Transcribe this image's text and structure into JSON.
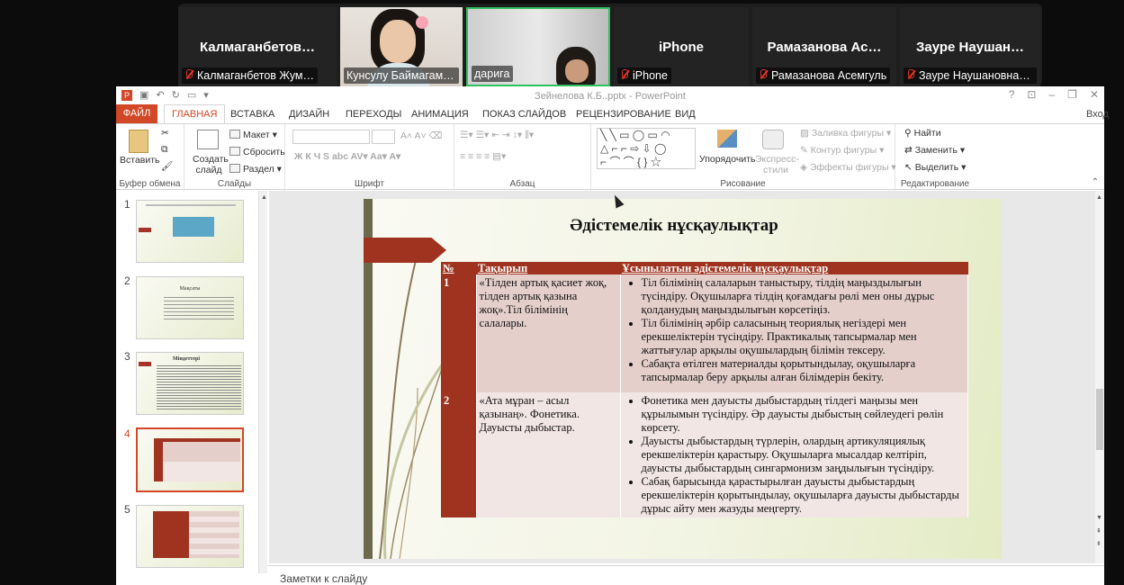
{
  "zoom": {
    "tiles": [
      {
        "name": "Калмаганбетов…",
        "label": "Калмаганбетов Жум…",
        "muted": true
      },
      {
        "name": "",
        "label": "Кунсулу Баймагамбетова",
        "muted": false
      },
      {
        "name": "",
        "label": "дарига",
        "muted": false
      },
      {
        "name": "iPhone",
        "label": "iPhone",
        "muted": true
      },
      {
        "name": "Рамазанова  Ас…",
        "label": "Рамазанова Асемгуль",
        "muted": true
      },
      {
        "name": "Зауре   Наушан…",
        "label": "Зауре   Наушановна …",
        "muted": true
      }
    ]
  },
  "ppt": {
    "window_title": "Зейнелова К.Б..pptx - PowerPoint",
    "tabs": [
      "ФАЙЛ",
      "ГЛАВНАЯ",
      "ВСТАВКА",
      "ДИЗАЙН",
      "ПЕРЕХОДЫ",
      "АНИМАЦИЯ",
      "ПОКАЗ СЛАЙДОВ",
      "РЕЦЕНЗИРОВАНИЕ",
      "ВИД"
    ],
    "signin": "Вход",
    "ribbon": {
      "paste": "Вставить",
      "clipboard": "Буфер обмена",
      "new_slide": "Создать слайд",
      "layout": "Макет",
      "reset": "Сбросить",
      "section": "Раздел",
      "slides": "Слайды",
      "font": "Шрифт",
      "paragraph": "Абзац",
      "arrange": "Упорядочить",
      "quick_styles": "Экспресс-стили",
      "shape_fill": "Заливка фигуры",
      "shape_outline": "Контур фигуры",
      "shape_effects": "Эффекты фигуры",
      "drawing": "Рисование",
      "find": "Найти",
      "replace": "Заменить",
      "select": "Выделить",
      "editing": "Редактирование"
    },
    "thumbnails": [
      {
        "num": "1",
        "selected": false
      },
      {
        "num": "2",
        "selected": false
      },
      {
        "num": "3",
        "selected": false
      },
      {
        "num": "4",
        "selected": true
      },
      {
        "num": "5",
        "selected": false
      }
    ],
    "thumb2_title": "Мақсаты",
    "thumb3_title": "Міндеттері",
    "slide": {
      "title": "Әдістемелік нұсқаулықтар",
      "headers": [
        "№",
        "Тақырып",
        "Ұсынылатын әдістемелік нұсқаулықтар"
      ],
      "rows": [
        {
          "num": "1",
          "topic": "«Тілден артық қасиет жоқ, тілден артық қазына жоқ».Тіл білімінің салалары.",
          "items": [
            "Тіл білімінің салаларын таныстыру, тілдің маңыздылығын түсіндіру. Оқушыларға тілдің қоғамдағы рөлі мен оны дұрыс қолданудың маңыздылығын көрсетіңіз.",
            "Тіл білімінің әрбір саласының теориялық негіздері мен ерекшеліктерін түсіндіру. Практикалық тапсырмалар мен жаттығулар арқылы оқушылардың білімін тексеру.",
            "Сабақта өтілген материалды қорытындылау, оқушыларға тапсырмалар беру арқылы алған білімдерін бекіту."
          ]
        },
        {
          "num": "2",
          "topic": "«Ата мұран – асыл қазынаң». Фонетика. Дауысты дыбыстар.",
          "items": [
            "Фонетика мен дауысты дыбыстардың тілдегі маңызы мен құрылымын түсіндіру. Әр дауысты дыбыстың сөйлеудегі рөлін көрсету.",
            "Дауысты дыбыстардың түрлерін, олардың артикуляциялық ерекшеліктерін қарастыру. Оқушыларға мысалдар келтіріп, дауысты дыбыстардың сингармонизм заңдылығын түсіндіру.",
            "Сабақ барысында қарастырылған дауысты дыбыстардың ерекшеліктерін қорытындылау, оқушыларға дауысты дыбыстарды дұрыс айту мен жазуды меңгерту."
          ]
        }
      ]
    },
    "notes": "Заметки к слайду"
  },
  "colors": {
    "accent": "#d24726",
    "slide_red": "#a0331f",
    "mic_off": "#e0352b",
    "active_speaker": "#2fc060"
  }
}
